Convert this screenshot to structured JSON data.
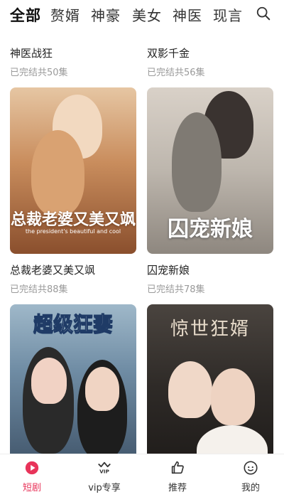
{
  "tabs": [
    "全部",
    "赘婿",
    "神豪",
    "美女",
    "神医",
    "现言"
  ],
  "items": [
    {
      "title": "神医战狂",
      "subtitle": "已完结共50集"
    },
    {
      "title": "双影千金",
      "subtitle": "已完结共56集"
    },
    {
      "title": "总裁老婆又美又飒",
      "subtitle": "已完结共88集"
    },
    {
      "title": "囚宠新娘",
      "subtitle": "已完结共78集"
    }
  ],
  "posters": {
    "p1_title": "总裁老婆又美又飒",
    "p1_sub": "the president's beautiful and cool",
    "p2_title": "囚宠新娘",
    "p3_title": "超级狂妻",
    "p4_title": "惊世狂婿"
  },
  "nav": [
    {
      "label": "短剧",
      "icon": "play-icon"
    },
    {
      "label": "vip专享",
      "icon": "vip-crown-icon"
    },
    {
      "label": "推荐",
      "icon": "thumbs-up-icon"
    },
    {
      "label": "我的",
      "icon": "profile-face-icon"
    }
  ],
  "colors": {
    "accent": "#e8345a"
  }
}
